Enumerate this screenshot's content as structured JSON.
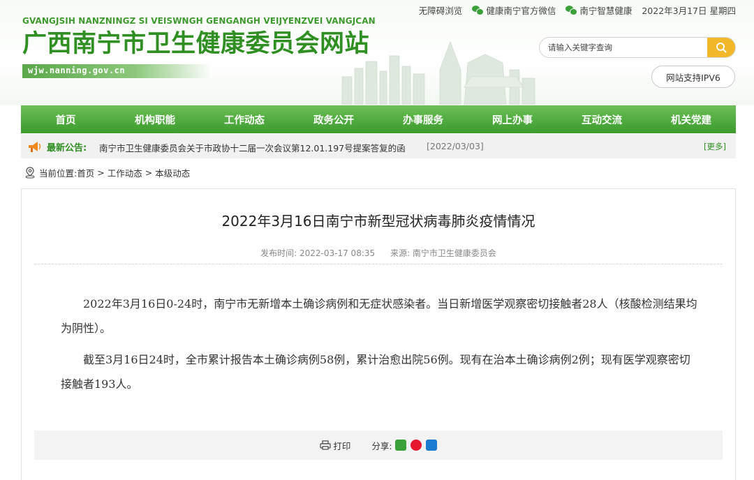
{
  "header": {
    "pinyin": "GVANGJSIH NANZNINGZ SI VEISWNGH GENGANGH VEIJYENZVEI VANGJCAN",
    "site_title": "广西南宁市卫生健康委员会网站",
    "domain": "wjw.nanning.gov.cn",
    "toplinks": {
      "accessibility": "无障碍浏览",
      "wechat1": "健康南宁官方微信",
      "wechat2": "南宁智慧健康",
      "date": "2022年3月17日 星期四"
    },
    "search": {
      "placeholder": "请输入关键字查询"
    },
    "ipv6": "网站支持IPV6",
    "colors": {
      "brand_green": "#2f8f22",
      "search_button": "#f3b72a"
    }
  },
  "nav": {
    "items": [
      {
        "label": "首页"
      },
      {
        "label": "机构职能"
      },
      {
        "label": "工作动态"
      },
      {
        "label": "政务公开"
      },
      {
        "label": "办事服务"
      },
      {
        "label": "网上办事"
      },
      {
        "label": "互动交流"
      },
      {
        "label": "机关党建"
      }
    ]
  },
  "notice": {
    "label": "最新公告:",
    "text": "南宁市卫生健康委员会关于市政协十二届一次会议第12.01.197号提案答复的函",
    "date": "[2022/03/03]",
    "more": "[更多]"
  },
  "breadcrumb": {
    "label": "当前位置:",
    "items": [
      "首页",
      "工作动态",
      "本级动态"
    ],
    "sep": ">"
  },
  "article": {
    "title": "2022年3月16日南宁市新型冠状病毒肺炎疫情情况",
    "publish_label": "发布时间:",
    "publish_time": "2022-03-17 08:35",
    "source_label": "来源:",
    "source": "南宁市卫生健康委员会",
    "paragraphs": [
      "2022年3月16日0-24时，南宁市无新增本土确诊病例和无症状感染者。当日新增医学观察密切接触者28人（核酸检测结果均为阴性）。",
      "截至3月16日24时，全市累计报告本土确诊病例58例，累计治愈出院56例。现有在治本土确诊病例2例；现有医学观察密切接触者193人。"
    ],
    "print_label": "打印",
    "share_label": "分享:"
  }
}
